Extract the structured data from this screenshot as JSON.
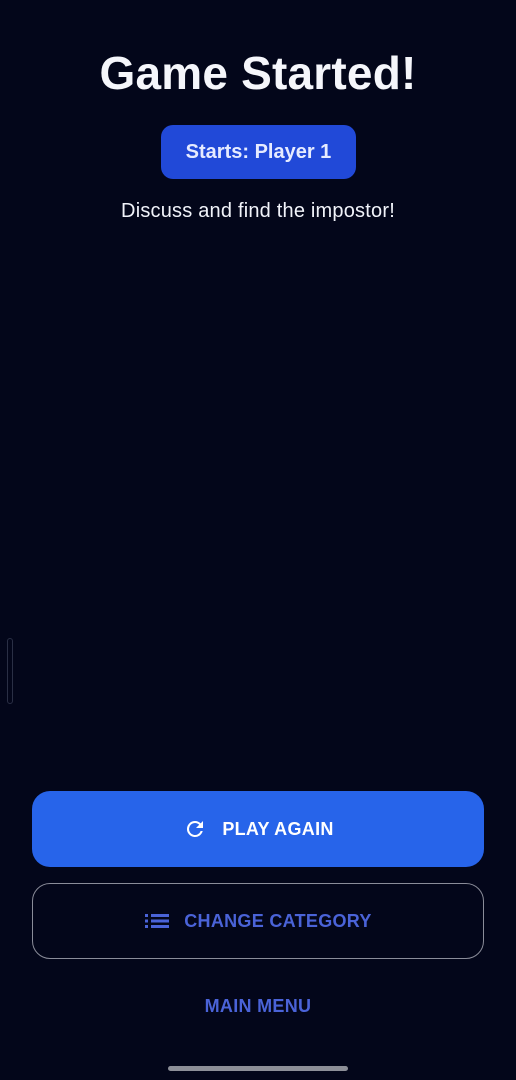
{
  "header": {
    "title": "Game Started!"
  },
  "badge": {
    "label": "Starts: Player 1"
  },
  "instruction": "Discuss and find the impostor!",
  "actions": {
    "play_again": {
      "label": "PLAY AGAIN",
      "icon": "refresh-icon"
    },
    "change_category": {
      "label": "CHANGE CATEGORY",
      "icon": "list-icon"
    },
    "main_menu": {
      "label": "MAIN MENU"
    }
  },
  "colors": {
    "background": "#03061a",
    "primary": "#2764ea",
    "badge": "#2149d8",
    "accent_text": "#4a63d8"
  }
}
